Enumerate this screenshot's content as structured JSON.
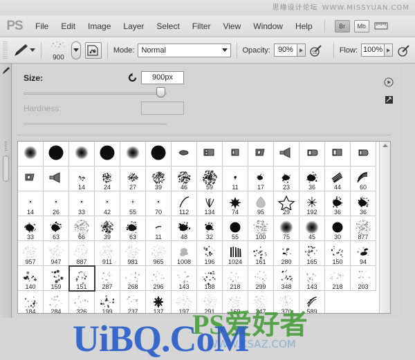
{
  "app": {
    "name": "PS",
    "logo_text": "PS"
  },
  "watermarks": {
    "top_cn": "思缘设计论坛",
    "top_url": "WWW.MISSYUAN.COM",
    "bottom_main": "UiBQ.CoM",
    "bottom_green": "PS爱好者",
    "bottom_small": "WWW.KSAZ.COM"
  },
  "menubar": {
    "items": [
      {
        "label": "File"
      },
      {
        "label": "Edit"
      },
      {
        "label": "Image"
      },
      {
        "label": "Layer"
      },
      {
        "label": "Select"
      },
      {
        "label": "Filter"
      },
      {
        "label": "View"
      },
      {
        "label": "Window"
      },
      {
        "label": "Help"
      }
    ],
    "bridge_button": "Br",
    "minibridge_button": "Mb"
  },
  "options_bar": {
    "brush_preset_size": "900",
    "mode_label": "Mode:",
    "mode_value": "Normal",
    "opacity_label": "Opacity:",
    "opacity_value": "90%",
    "flow_label": "Flow:",
    "flow_value": "100%"
  },
  "brush_panel": {
    "size_label": "Size:",
    "size_value": "900px",
    "hardness_label": "Hardness:",
    "hardness_value": "",
    "size_slider_percent": 93
  },
  "brush_grid": {
    "selected_number": "151",
    "columns": 14,
    "rows": [
      [
        {
          "n": "",
          "k": "soft-round-small"
        },
        {
          "n": "",
          "k": "hard-round-large"
        },
        {
          "n": "",
          "k": "soft-round-small"
        },
        {
          "n": "",
          "k": "hard-round-large"
        },
        {
          "n": "",
          "k": "soft-round-small"
        },
        {
          "n": "",
          "k": "hard-round-large"
        },
        {
          "n": "",
          "k": "flat-tip-a"
        },
        {
          "n": "",
          "k": "flat-block-b"
        },
        {
          "n": "",
          "k": "flat-block-c"
        },
        {
          "n": "",
          "k": "flat-block-d"
        },
        {
          "n": "",
          "k": "fan-tip"
        },
        {
          "n": "",
          "k": "flat-block-e"
        },
        {
          "n": "",
          "k": "flat-block-f"
        },
        {
          "n": "",
          "k": "flat-block-g"
        }
      ],
      [
        {
          "n": "",
          "k": "flat-block-d"
        },
        {
          "n": "",
          "k": "fan-tip"
        },
        {
          "n": "14",
          "k": "spatter-tiny"
        },
        {
          "n": "24",
          "k": "spatter-sm"
        },
        {
          "n": "27",
          "k": "spatter-sm"
        },
        {
          "n": "39",
          "k": "spatter-md"
        },
        {
          "n": "46",
          "k": "spatter-md"
        },
        {
          "n": "59",
          "k": "spatter-lg"
        },
        {
          "n": "11",
          "k": "chalk-tiny"
        },
        {
          "n": "17",
          "k": "chalk-sm"
        },
        {
          "n": "23",
          "k": "chalk-md"
        },
        {
          "n": "36",
          "k": "chalk-lg"
        },
        {
          "n": "44",
          "k": "hatch-a"
        },
        {
          "n": "60",
          "k": "hatch-b"
        }
      ],
      [
        {
          "n": "14",
          "k": "pin-dot"
        },
        {
          "n": "26",
          "k": "pin-dot"
        },
        {
          "n": "33",
          "k": "pin-dot"
        },
        {
          "n": "42",
          "k": "pin-dot"
        },
        {
          "n": "55",
          "k": "pin-star"
        },
        {
          "n": "70",
          "k": "pin-dot"
        },
        {
          "n": "112",
          "k": "curve-stroke"
        },
        {
          "n": "134",
          "k": "grass"
        },
        {
          "n": "74",
          "k": "maple-leaf"
        },
        {
          "n": "95",
          "k": "leaf-gray"
        },
        {
          "n": "29",
          "k": "star-outline"
        },
        {
          "n": "192",
          "k": "spark"
        },
        {
          "n": "36",
          "k": "chalk-lg"
        },
        {
          "n": "36",
          "k": "chalk-lg"
        }
      ],
      [
        {
          "n": "33",
          "k": "chalk-lg"
        },
        {
          "n": "63",
          "k": "chalk-lg"
        },
        {
          "n": "66",
          "k": "spatter-fade"
        },
        {
          "n": "39",
          "k": "spatter-md"
        },
        {
          "n": "63",
          "k": "chalk-lg"
        },
        {
          "n": "11",
          "k": "tiny-stroke"
        },
        {
          "n": "48",
          "k": "chalk-lg"
        },
        {
          "n": "32",
          "k": "chalk-md"
        },
        {
          "n": "55",
          "k": "solid-round"
        },
        {
          "n": "100",
          "k": "spatter-fade"
        },
        {
          "n": "75",
          "k": "soft-round-small"
        },
        {
          "n": "45",
          "k": "soft-round-small"
        },
        {
          "n": "30",
          "k": "solid-round"
        },
        {
          "n": "877",
          "k": "spatter-fade"
        }
      ],
      [
        {
          "n": "957",
          "k": "spray-faint"
        },
        {
          "n": "947",
          "k": "spray-faint"
        },
        {
          "n": "887",
          "k": "spray-faint"
        },
        {
          "n": "911",
          "k": "spray-faint"
        },
        {
          "n": "981",
          "k": "spray-faint"
        },
        {
          "n": "965",
          "k": "spray-faint"
        },
        {
          "n": "1008",
          "k": "smoke"
        },
        {
          "n": "196",
          "k": "dots-sparse"
        },
        {
          "n": "1024",
          "k": "brush-strokes"
        },
        {
          "n": "161",
          "k": "dots-sparse"
        },
        {
          "n": "280",
          "k": "dots-dash"
        },
        {
          "n": "165",
          "k": "dots-sparse"
        },
        {
          "n": "150",
          "k": "dots-sparse"
        },
        {
          "n": "94",
          "k": "blob-smear"
        }
      ],
      [
        {
          "n": "140",
          "k": "dots-bold"
        },
        {
          "n": "159",
          "k": "dots-bold"
        },
        {
          "n": "151",
          "k": "dots-sparse"
        },
        {
          "n": "287",
          "k": "dots-faint"
        },
        {
          "n": "268",
          "k": "dots-faint"
        },
        {
          "n": "296",
          "k": "dots-faint"
        },
        {
          "n": "143",
          "k": "dots-faint"
        },
        {
          "n": "188",
          "k": "dots-sparse"
        },
        {
          "n": "218",
          "k": "dots-faint"
        },
        {
          "n": "299",
          "k": "dots-faint"
        },
        {
          "n": "348",
          "k": "dots-sparse"
        },
        {
          "n": "143",
          "k": "dots-faint"
        },
        {
          "n": "218",
          "k": "dots-faint"
        },
        {
          "n": "203",
          "k": "dots-faint"
        }
      ],
      [
        {
          "n": "184",
          "k": "dots-sparse"
        },
        {
          "n": "284",
          "k": "dots-faint"
        },
        {
          "n": "326",
          "k": "dots-faint"
        },
        {
          "n": "199",
          "k": "dots-sparse"
        },
        {
          "n": "237",
          "k": "dots-faint"
        },
        {
          "n": "137",
          "k": "snowflake"
        },
        {
          "n": "197",
          "k": "spray-faint"
        },
        {
          "n": "291",
          "k": "spray-faint"
        },
        {
          "n": "169",
          "k": "spray-faint"
        },
        {
          "n": "247",
          "k": "spray-faint"
        },
        {
          "n": "370",
          "k": "spray-faint"
        },
        {
          "n": "589",
          "k": "scratch"
        }
      ]
    ]
  }
}
